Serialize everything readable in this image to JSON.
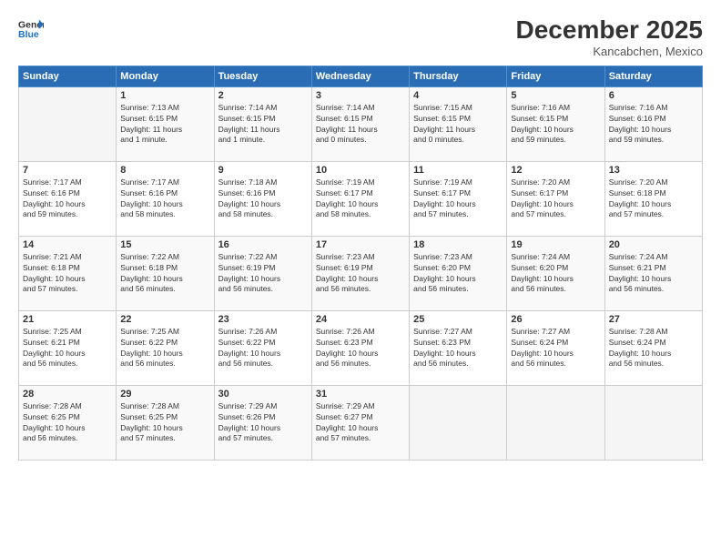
{
  "header": {
    "logo_line1": "General",
    "logo_line2": "Blue",
    "month": "December 2025",
    "location": "Kancabchen, Mexico"
  },
  "weekdays": [
    "Sunday",
    "Monday",
    "Tuesday",
    "Wednesday",
    "Thursday",
    "Friday",
    "Saturday"
  ],
  "weeks": [
    [
      {
        "day": "",
        "info": ""
      },
      {
        "day": "1",
        "info": "Sunrise: 7:13 AM\nSunset: 6:15 PM\nDaylight: 11 hours\nand 1 minute."
      },
      {
        "day": "2",
        "info": "Sunrise: 7:14 AM\nSunset: 6:15 PM\nDaylight: 11 hours\nand 1 minute."
      },
      {
        "day": "3",
        "info": "Sunrise: 7:14 AM\nSunset: 6:15 PM\nDaylight: 11 hours\nand 0 minutes."
      },
      {
        "day": "4",
        "info": "Sunrise: 7:15 AM\nSunset: 6:15 PM\nDaylight: 11 hours\nand 0 minutes."
      },
      {
        "day": "5",
        "info": "Sunrise: 7:16 AM\nSunset: 6:15 PM\nDaylight: 10 hours\nand 59 minutes."
      },
      {
        "day": "6",
        "info": "Sunrise: 7:16 AM\nSunset: 6:16 PM\nDaylight: 10 hours\nand 59 minutes."
      }
    ],
    [
      {
        "day": "7",
        "info": "Sunrise: 7:17 AM\nSunset: 6:16 PM\nDaylight: 10 hours\nand 59 minutes."
      },
      {
        "day": "8",
        "info": "Sunrise: 7:17 AM\nSunset: 6:16 PM\nDaylight: 10 hours\nand 58 minutes."
      },
      {
        "day": "9",
        "info": "Sunrise: 7:18 AM\nSunset: 6:16 PM\nDaylight: 10 hours\nand 58 minutes."
      },
      {
        "day": "10",
        "info": "Sunrise: 7:19 AM\nSunset: 6:17 PM\nDaylight: 10 hours\nand 58 minutes."
      },
      {
        "day": "11",
        "info": "Sunrise: 7:19 AM\nSunset: 6:17 PM\nDaylight: 10 hours\nand 57 minutes."
      },
      {
        "day": "12",
        "info": "Sunrise: 7:20 AM\nSunset: 6:17 PM\nDaylight: 10 hours\nand 57 minutes."
      },
      {
        "day": "13",
        "info": "Sunrise: 7:20 AM\nSunset: 6:18 PM\nDaylight: 10 hours\nand 57 minutes."
      }
    ],
    [
      {
        "day": "14",
        "info": "Sunrise: 7:21 AM\nSunset: 6:18 PM\nDaylight: 10 hours\nand 57 minutes."
      },
      {
        "day": "15",
        "info": "Sunrise: 7:22 AM\nSunset: 6:18 PM\nDaylight: 10 hours\nand 56 minutes."
      },
      {
        "day": "16",
        "info": "Sunrise: 7:22 AM\nSunset: 6:19 PM\nDaylight: 10 hours\nand 56 minutes."
      },
      {
        "day": "17",
        "info": "Sunrise: 7:23 AM\nSunset: 6:19 PM\nDaylight: 10 hours\nand 56 minutes."
      },
      {
        "day": "18",
        "info": "Sunrise: 7:23 AM\nSunset: 6:20 PM\nDaylight: 10 hours\nand 56 minutes."
      },
      {
        "day": "19",
        "info": "Sunrise: 7:24 AM\nSunset: 6:20 PM\nDaylight: 10 hours\nand 56 minutes."
      },
      {
        "day": "20",
        "info": "Sunrise: 7:24 AM\nSunset: 6:21 PM\nDaylight: 10 hours\nand 56 minutes."
      }
    ],
    [
      {
        "day": "21",
        "info": "Sunrise: 7:25 AM\nSunset: 6:21 PM\nDaylight: 10 hours\nand 56 minutes."
      },
      {
        "day": "22",
        "info": "Sunrise: 7:25 AM\nSunset: 6:22 PM\nDaylight: 10 hours\nand 56 minutes."
      },
      {
        "day": "23",
        "info": "Sunrise: 7:26 AM\nSunset: 6:22 PM\nDaylight: 10 hours\nand 56 minutes."
      },
      {
        "day": "24",
        "info": "Sunrise: 7:26 AM\nSunset: 6:23 PM\nDaylight: 10 hours\nand 56 minutes."
      },
      {
        "day": "25",
        "info": "Sunrise: 7:27 AM\nSunset: 6:23 PM\nDaylight: 10 hours\nand 56 minutes."
      },
      {
        "day": "26",
        "info": "Sunrise: 7:27 AM\nSunset: 6:24 PM\nDaylight: 10 hours\nand 56 minutes."
      },
      {
        "day": "27",
        "info": "Sunrise: 7:28 AM\nSunset: 6:24 PM\nDaylight: 10 hours\nand 56 minutes."
      }
    ],
    [
      {
        "day": "28",
        "info": "Sunrise: 7:28 AM\nSunset: 6:25 PM\nDaylight: 10 hours\nand 56 minutes."
      },
      {
        "day": "29",
        "info": "Sunrise: 7:28 AM\nSunset: 6:25 PM\nDaylight: 10 hours\nand 57 minutes."
      },
      {
        "day": "30",
        "info": "Sunrise: 7:29 AM\nSunset: 6:26 PM\nDaylight: 10 hours\nand 57 minutes."
      },
      {
        "day": "31",
        "info": "Sunrise: 7:29 AM\nSunset: 6:27 PM\nDaylight: 10 hours\nand 57 minutes."
      },
      {
        "day": "",
        "info": ""
      },
      {
        "day": "",
        "info": ""
      },
      {
        "day": "",
        "info": ""
      }
    ]
  ]
}
